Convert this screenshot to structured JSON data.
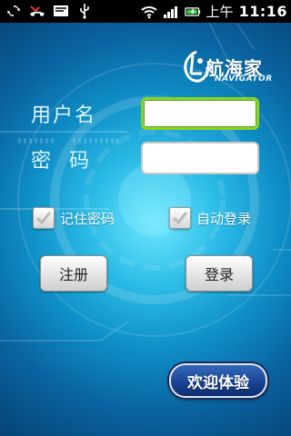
{
  "status_bar": {
    "ampm": "上午",
    "time": "11:16",
    "left_icons": [
      "sync-icon",
      "missed-call-icon",
      "message-icon",
      "usb-icon"
    ],
    "right_icons": [
      "wifi-icon",
      "signal-icon",
      "battery-charging-icon"
    ]
  },
  "logo": {
    "name_cn": "航海家",
    "name_en": "NAVIGATOR"
  },
  "form": {
    "username_label": "用户名",
    "password_label": "密  码",
    "username_value": "",
    "password_value": ""
  },
  "options": {
    "remember_password": "记住密码",
    "auto_login": "自动登录",
    "remember_checked": true,
    "auto_login_checked": true
  },
  "buttons": {
    "register": "注册",
    "login": "登录",
    "experience": "欢迎体验"
  },
  "colors": {
    "focus_border": "#8bd321",
    "background_accent": "#2bbbe6"
  }
}
